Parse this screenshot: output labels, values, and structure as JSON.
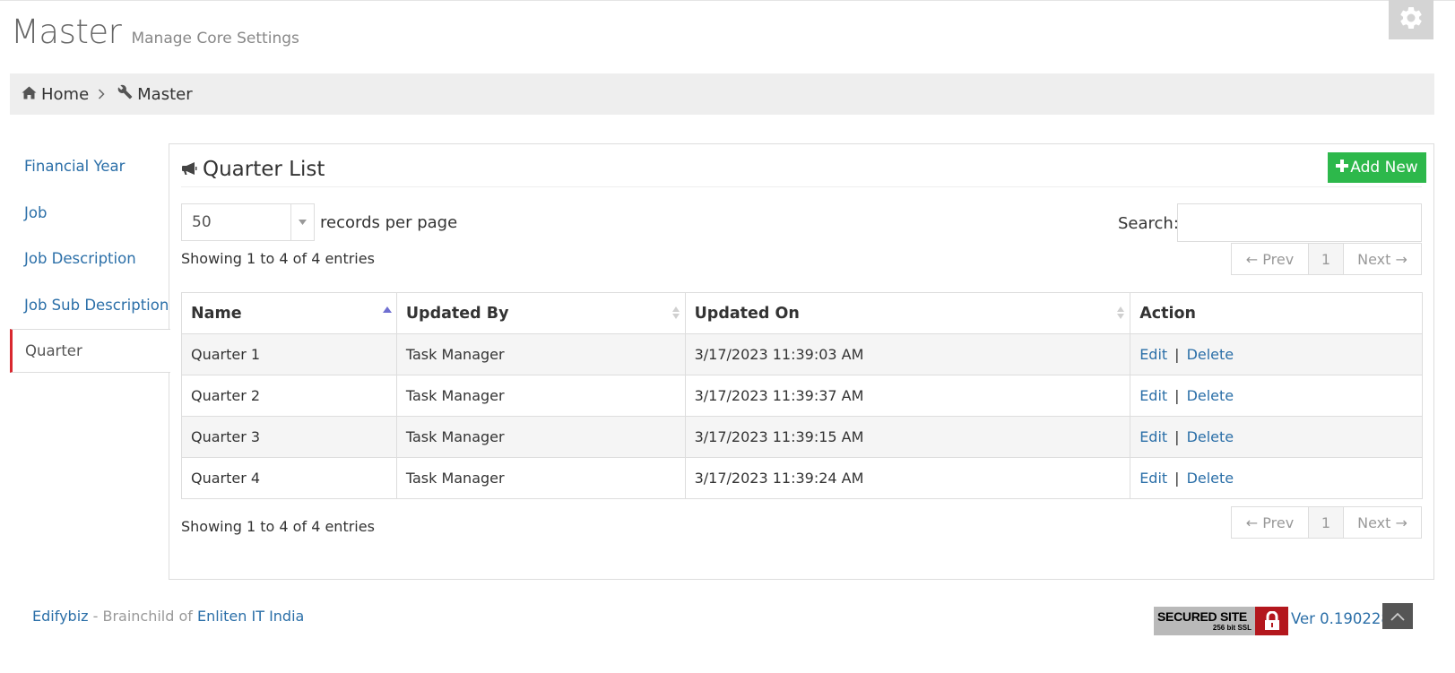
{
  "header": {
    "title": "Master",
    "subtitle": "Manage Core Settings"
  },
  "breadcrumb": [
    {
      "label": "Home",
      "icon": "home-icon"
    },
    {
      "label": "Master",
      "icon": "wrench-icon"
    }
  ],
  "sidebar": {
    "items": [
      {
        "label": "Financial Year",
        "active": false
      },
      {
        "label": "Job",
        "active": false
      },
      {
        "label": "Job Description",
        "active": false
      },
      {
        "label": "Job Sub Description",
        "active": false
      },
      {
        "label": "Quarter",
        "active": true
      }
    ]
  },
  "portlet": {
    "caption": "Quarter List",
    "add_button": "Add New",
    "records_per_page_value": "50",
    "records_per_page_label": "records per page",
    "search_label": "Search:",
    "search_value": "",
    "info_top": "Showing 1 to 4 of 4 entries",
    "info_bottom": "Showing 1 to 4 of 4 entries",
    "pager": {
      "prev": "← Prev",
      "page": "1",
      "next": "Next →"
    }
  },
  "table": {
    "columns": [
      "Name",
      "Updated By",
      "Updated On",
      "Action"
    ],
    "sorted_column": "Name",
    "sort_direction": "ascending",
    "rows": [
      {
        "name": "Quarter 1",
        "updated_by": "Task Manager",
        "updated_on": "3/17/2023 11:39:03 AM"
      },
      {
        "name": "Quarter 2",
        "updated_by": "Task Manager",
        "updated_on": "3/17/2023 11:39:37 AM"
      },
      {
        "name": "Quarter 3",
        "updated_by": "Task Manager",
        "updated_on": "3/17/2023 11:39:15 AM"
      },
      {
        "name": "Quarter 4",
        "updated_by": "Task Manager",
        "updated_on": "3/17/2023 11:39:24 AM"
      }
    ],
    "actions": {
      "edit": "Edit",
      "separator": "|",
      "delete": "Delete"
    }
  },
  "footer": {
    "brand": "Edifybiz",
    "text": " - Brainchild of ",
    "company": "Enliten IT India",
    "ssl_main": "SECURED SITE",
    "ssl_sub": "256 bit SSL",
    "version": "Ver 0.190228"
  },
  "colors": {
    "link": "#2b6fa8",
    "add_button": "#2db84b",
    "active_nav_border": "#d9282f",
    "breadcrumb_bg": "#eeeeee",
    "ssl_lock": "#b3171d"
  },
  "icons": [
    "gear-icon",
    "home-icon",
    "chevron-right-icon",
    "wrench-icon",
    "bullhorn-icon",
    "plus-icon",
    "caret-down-icon",
    "sort-asc-icon",
    "sort-both-icon",
    "lock-icon",
    "chevron-up-icon"
  ]
}
